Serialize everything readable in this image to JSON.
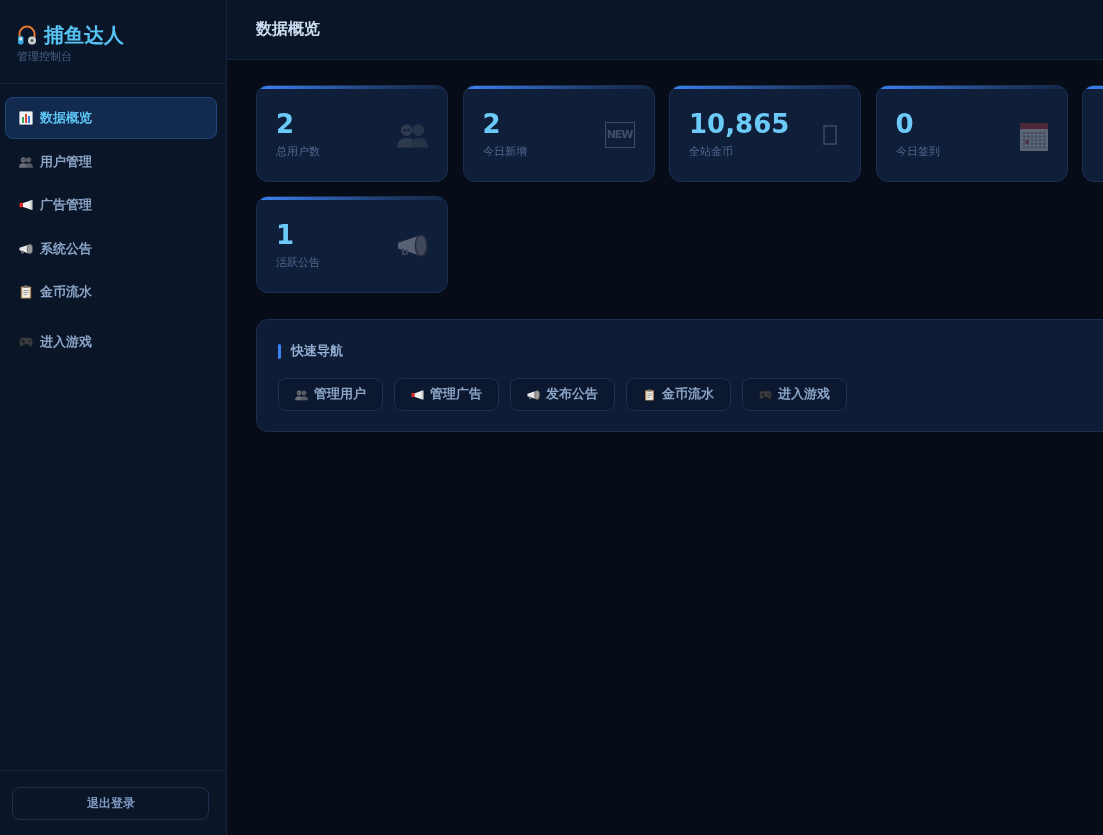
{
  "sidebar": {
    "logo": {
      "title": "捕鱼达人",
      "subtitle": "管理控制台"
    },
    "nav": [
      {
        "label": "数据概览",
        "selected": true
      },
      {
        "label": "用户管理",
        "selected": false
      },
      {
        "label": "广告管理",
        "selected": false
      },
      {
        "label": "系统公告",
        "selected": false
      },
      {
        "label": "金币流水",
        "selected": false
      },
      {
        "label": "进入游戏",
        "selected": false
      }
    ],
    "logout": "退出登录"
  },
  "header": {
    "title": "数据概览"
  },
  "stats": [
    {
      "kind": "full",
      "value": "2",
      "label": "总用户数"
    },
    {
      "kind": "full",
      "value": "2",
      "label": "今日新增",
      "icon_text": "NEW"
    },
    {
      "kind": "full",
      "value": "10,865",
      "label": "全站金币"
    },
    {
      "kind": "full",
      "value": "0",
      "label": "今日签到"
    },
    {
      "kind": "clipped"
    },
    {
      "kind": "full",
      "value": "1",
      "label": "活跃公告"
    }
  ],
  "quick_nav": {
    "title": "快速导航",
    "buttons": [
      "管理用户",
      "管理广告",
      "发布公告",
      "金币流水",
      "进入游戏"
    ]
  }
}
